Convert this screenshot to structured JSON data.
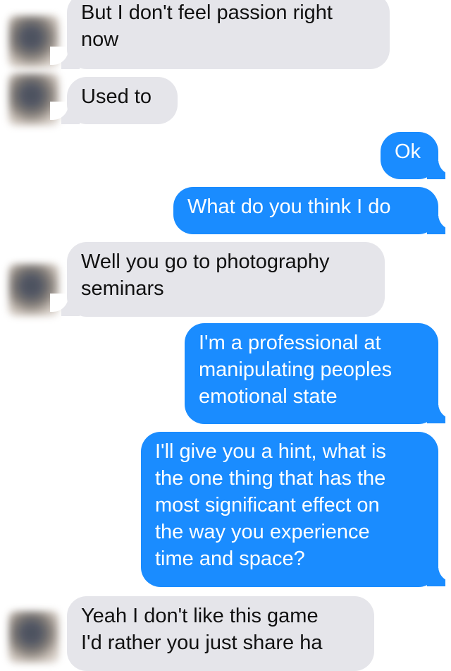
{
  "conversation": {
    "messages": [
      {
        "sender": "them",
        "text": "But I don't feel passion right\nnow"
      },
      {
        "sender": "them",
        "text": "Used to"
      },
      {
        "sender": "me",
        "text": "Ok"
      },
      {
        "sender": "me",
        "text": "What do you think I do"
      },
      {
        "sender": "them",
        "text": "Well you go to photography\nseminars"
      },
      {
        "sender": "me",
        "text": "I'm a professional at\nmanipulating peoples\nemotional state"
      },
      {
        "sender": "me",
        "text": "I'll give you a hint, what is\nthe one thing that has the\nmost significant effect on\nthe way you experience\ntime and space?"
      },
      {
        "sender": "them",
        "text": "Yeah I don't like this game\nI'd rather you just share ha"
      }
    ]
  },
  "colors": {
    "incoming_bubble": "#e5e5ea",
    "outgoing_bubble": "#1a8cff",
    "incoming_text": "#111111",
    "outgoing_text": "#ffffff"
  }
}
